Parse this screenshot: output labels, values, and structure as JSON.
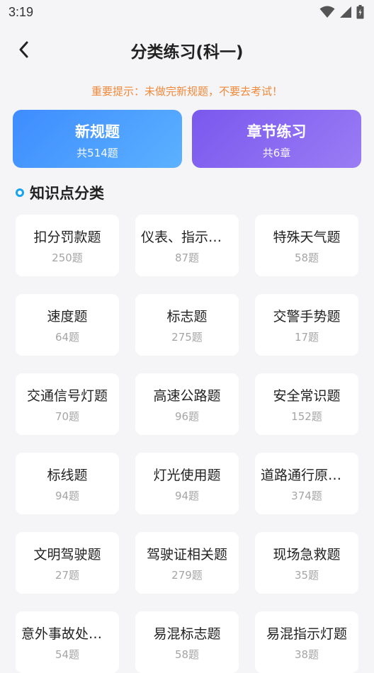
{
  "status": {
    "time": "3:19"
  },
  "nav": {
    "title": "分类练习(科一)"
  },
  "warning": "重要提示：未做完新规题，不要去考试！",
  "cards": [
    {
      "title": "新规题",
      "sub": "共514题"
    },
    {
      "title": "章节练习",
      "sub": "共6章"
    }
  ],
  "section": {
    "title": "知识点分类"
  },
  "categories": [
    {
      "name": "扣分罚款题",
      "count": "250题"
    },
    {
      "name": "仪表、指示灯题",
      "count": "87题"
    },
    {
      "name": "特殊天气题",
      "count": "58题"
    },
    {
      "name": "速度题",
      "count": "64题"
    },
    {
      "name": "标志题",
      "count": "275题"
    },
    {
      "name": "交警手势题",
      "count": "17题"
    },
    {
      "name": "交通信号灯题",
      "count": "70题"
    },
    {
      "name": "高速公路题",
      "count": "96题"
    },
    {
      "name": "安全常识题",
      "count": "152题"
    },
    {
      "name": "标线题",
      "count": "94题"
    },
    {
      "name": "灯光使用题",
      "count": "94题"
    },
    {
      "name": "道路通行原则题",
      "count": "374题"
    },
    {
      "name": "文明驾驶题",
      "count": "27题"
    },
    {
      "name": "驾驶证相关题",
      "count": "279题"
    },
    {
      "name": "现场急救题",
      "count": "35题"
    },
    {
      "name": "意外事故处理题",
      "count": "54题"
    },
    {
      "name": "易混标志题",
      "count": "58题"
    },
    {
      "name": "易混指示灯题",
      "count": "38题"
    }
  ]
}
